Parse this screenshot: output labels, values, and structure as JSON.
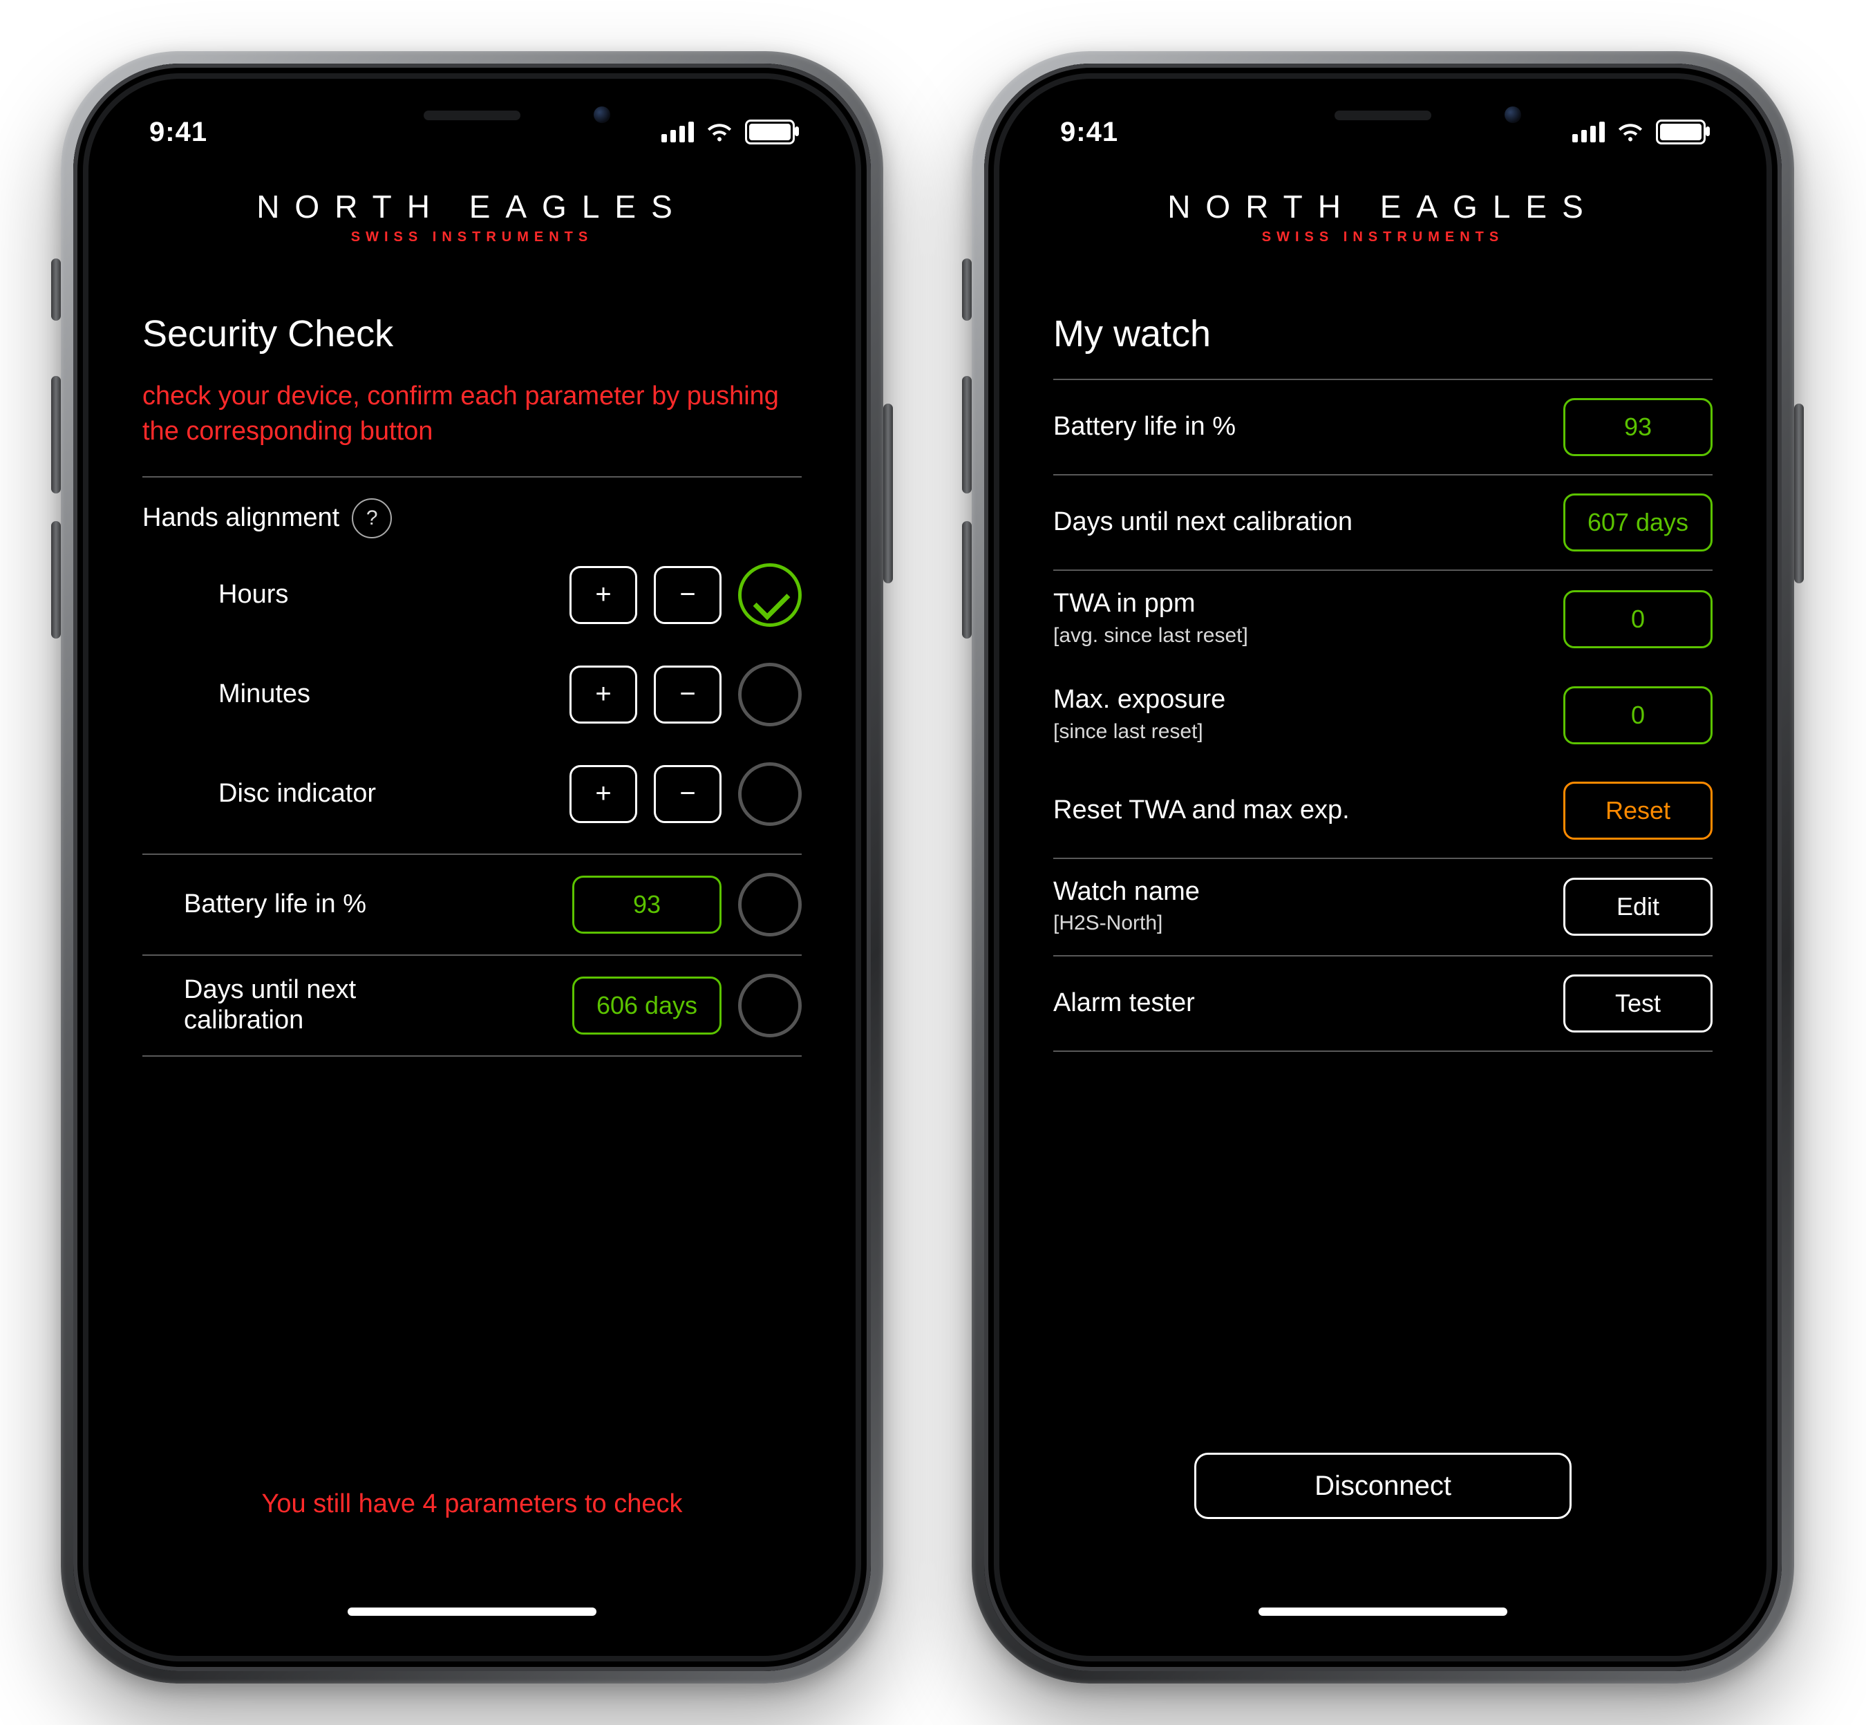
{
  "status": {
    "time": "9:41"
  },
  "brand": {
    "name": "NORTH EAGLES",
    "sub": "SWISS INSTRUMENTS"
  },
  "left": {
    "title": "Security Check",
    "instruction": "check your device, confirm each parameter by pushing the corresponding button",
    "hands_label": "Hands alignment",
    "hours_label": "Hours",
    "minutes_label": "Minutes",
    "disc_label": "Disc indicator",
    "plus": "+",
    "minus": "−",
    "battery_label": "Battery life in %",
    "battery_value": "93",
    "calib_label": "Days until next calibration",
    "calib_value": "606 days",
    "footer": "You still have 4 parameters to check"
  },
  "right": {
    "title": "My watch",
    "battery_label": "Battery life in %",
    "battery_value": "93",
    "calib_label": "Days until next calibration",
    "calib_value": "607 days",
    "twa_label": "TWA in ppm",
    "twa_sub": "[avg. since last reset]",
    "twa_value": "0",
    "max_label": "Max. exposure",
    "max_sub": "[since last reset]",
    "max_value": "0",
    "reset_label": "Reset TWA and max exp.",
    "reset_btn": "Reset",
    "name_label": "Watch name",
    "name_sub": "[H2S-North]",
    "edit_btn": "Edit",
    "alarm_label": "Alarm tester",
    "test_btn": "Test",
    "disconnect": "Disconnect"
  }
}
